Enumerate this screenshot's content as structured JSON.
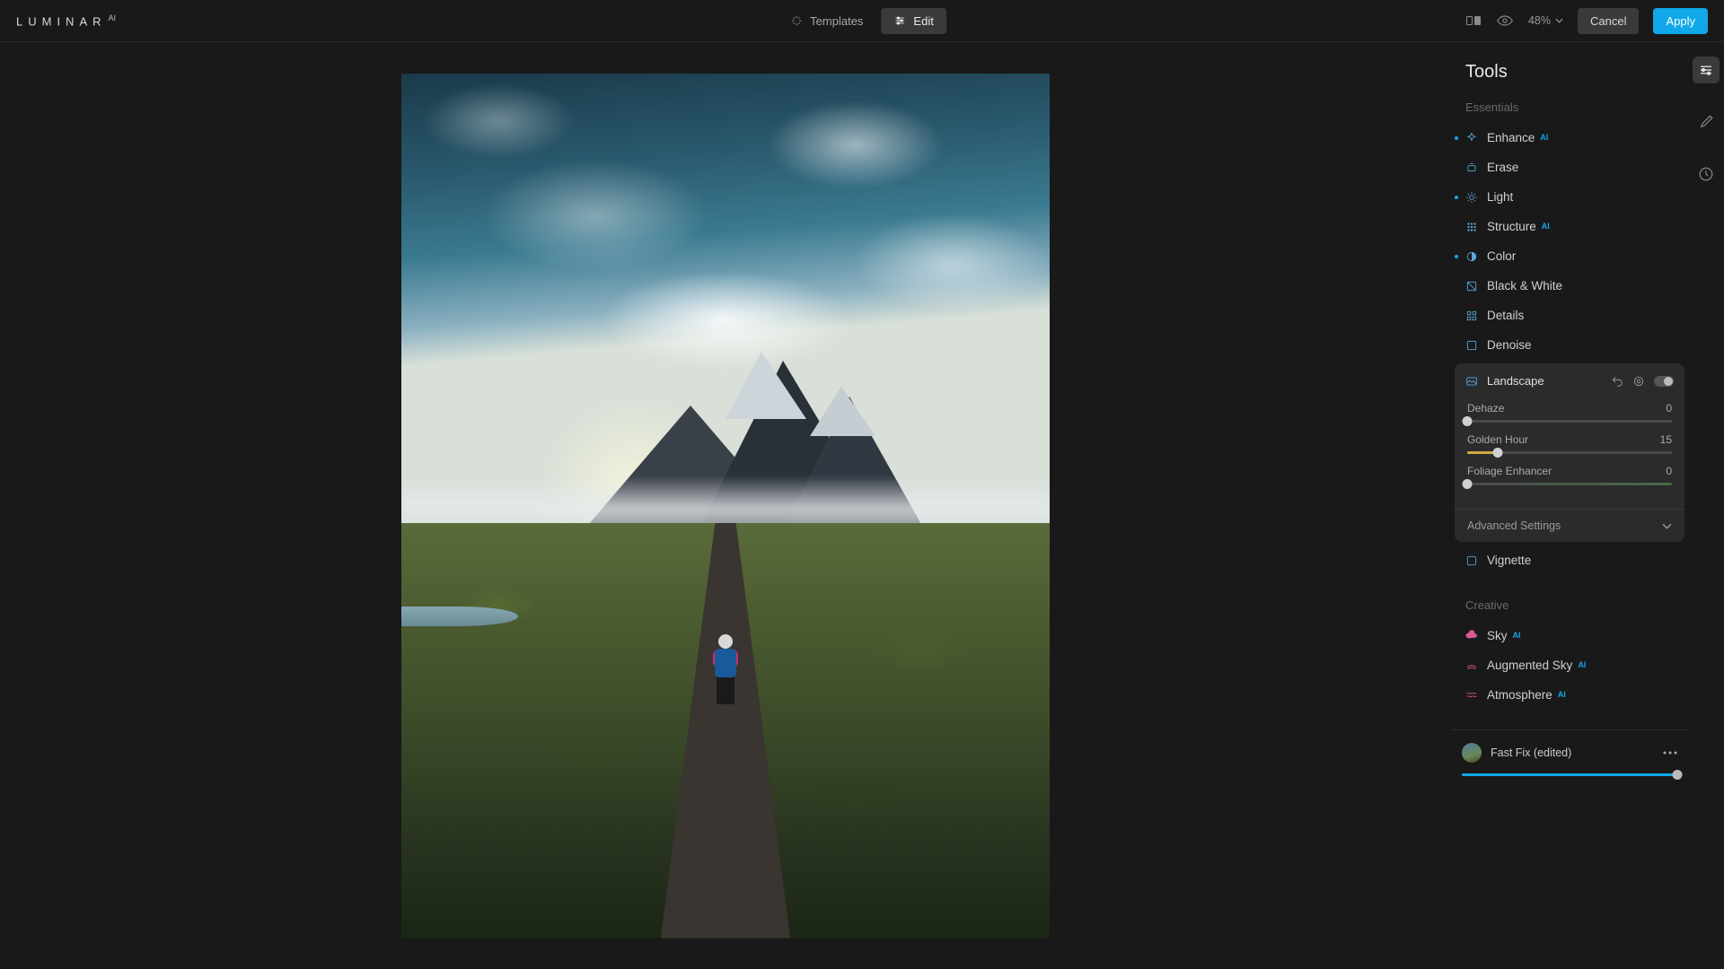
{
  "app_name": "LUMINAR",
  "app_suffix": "AI",
  "top_tabs": {
    "templates": "Templates",
    "edit": "Edit"
  },
  "zoom": "48%",
  "buttons": {
    "cancel": "Cancel",
    "apply": "Apply"
  },
  "panel_title": "Tools",
  "sections": {
    "essentials": "Essentials",
    "creative": "Creative"
  },
  "tools": {
    "enhance": "Enhance",
    "erase": "Erase",
    "light": "Light",
    "structure": "Structure",
    "color": "Color",
    "bw": "Black & White",
    "details": "Details",
    "denoise": "Denoise",
    "landscape": "Landscape",
    "vignette": "Vignette",
    "sky": "Sky",
    "aug_sky": "Augmented Sky",
    "atmosphere": "Atmosphere"
  },
  "ai_badge": "AI",
  "landscape": {
    "dehaze": {
      "label": "Dehaze",
      "value": "0",
      "pos": 0
    },
    "golden": {
      "label": "Golden Hour",
      "value": "15",
      "pos": 15
    },
    "foliage": {
      "label": "Foliage Enhancer",
      "value": "0",
      "pos": 0
    },
    "advanced": "Advanced Settings"
  },
  "preset": {
    "name": "Fast Fix (edited)"
  }
}
